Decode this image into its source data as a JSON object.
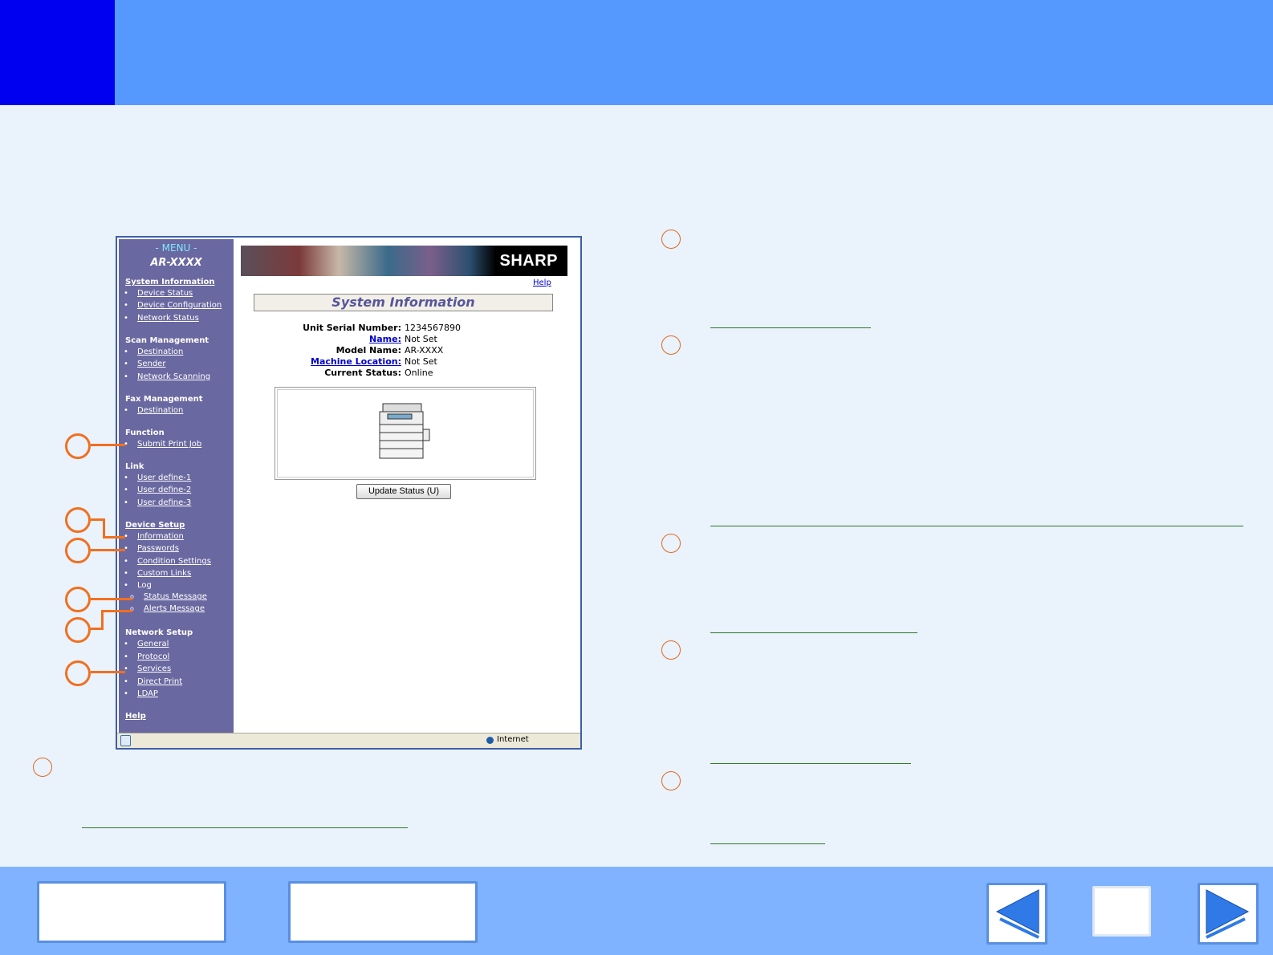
{
  "menu": {
    "title": "- MENU -",
    "model": "AR-XXXX",
    "sections": {
      "system_information": "System Information",
      "scan_management": "Scan Management",
      "fax_management": "Fax Management",
      "function": "Function",
      "link": "Link",
      "device_setup": "Device Setup",
      "network_setup": "Network Setup",
      "help": "Help"
    },
    "items": {
      "device_status": "Device Status",
      "device_configuration": "Device Configuration",
      "network_status": "Network Status",
      "scan_destination": "Destination",
      "sender": "Sender",
      "network_scanning": "Network Scanning",
      "fax_destination": "Destination",
      "submit_print_job": "Submit Print Job",
      "user_define_1": "User define-1",
      "user_define_2": "User define-2",
      "user_define_3": "User define-3",
      "information": "Information",
      "passwords": "Passwords",
      "condition_settings": "Condition Settings",
      "custom_links": "Custom Links",
      "log": "Log",
      "status_message": "Status Message",
      "alerts_message": "Alerts Message",
      "general": "General",
      "protocol": "Protocol",
      "services": "Services",
      "direct_print": "Direct Print",
      "ldap": "LDAP"
    }
  },
  "content": {
    "brand": "SHARP",
    "help_link": "Help",
    "page_title": "System Information",
    "fields": {
      "serial_label": "Unit Serial Number:",
      "serial_value": "1234567890",
      "name_label": "Name:",
      "name_value": "Not Set",
      "model_label": "Model Name:",
      "model_value": "AR-XXXX",
      "location_label": "Machine Location:",
      "location_value": "Not Set",
      "status_label": "Current Status:",
      "status_value": "Online"
    },
    "update_button": "Update Status (U)"
  },
  "statusbar": {
    "zone": "Internet"
  }
}
